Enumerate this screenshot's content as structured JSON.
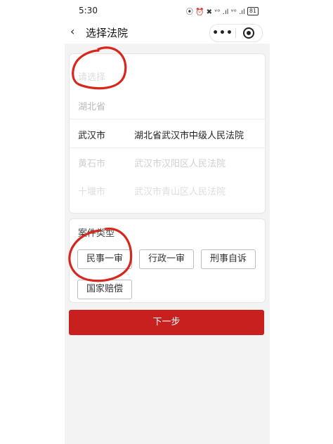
{
  "status_bar": {
    "time": "5:30",
    "icons": "⦿ ⏰ ✖ ᵛᵒ .ıl ᵛᵒ .ıl",
    "battery": "81"
  },
  "nav": {
    "back_icon": "chevron-left-icon",
    "title": "选择法院"
  },
  "picker": {
    "placeholder": "请选择",
    "rows": [
      {
        "province": "湖北省",
        "court": ""
      },
      {
        "province": "武汉市",
        "court": "湖北省武汉市中级人民法院"
      },
      {
        "province": "黄石市",
        "court": "武汉市汉阳区人民法院"
      },
      {
        "province": "十堰市",
        "court": "武汉市青山区人民法院"
      }
    ]
  },
  "case_types": {
    "title": "案件类型",
    "options": [
      "民事一审",
      "行政一审",
      "刑事自诉",
      "国家赔偿"
    ]
  },
  "next_button": "下一步",
  "colors": {
    "primary": "#c81f1f",
    "annotation": "#d9261c"
  }
}
